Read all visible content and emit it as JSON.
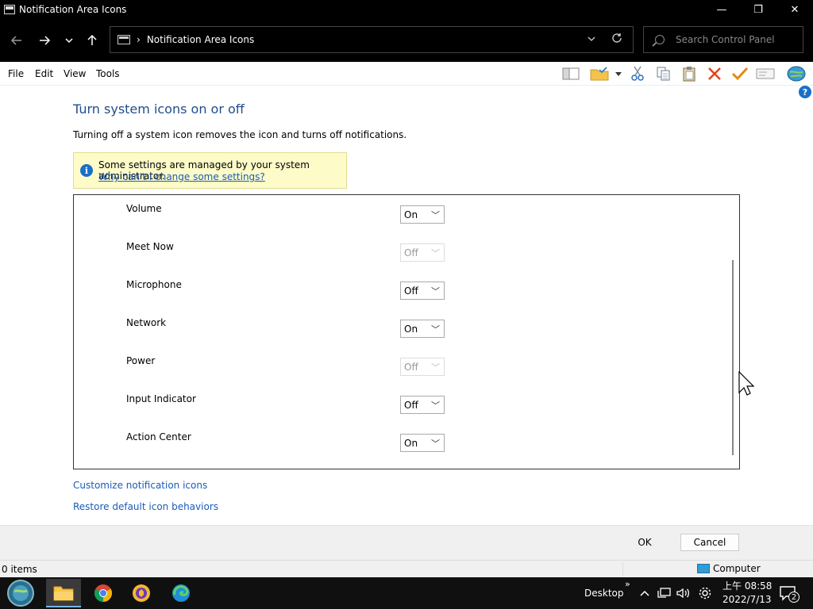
{
  "window": {
    "title": "Notification Area Icons",
    "min_glyph": "—",
    "max_glyph": "❐",
    "close_glyph": "✕"
  },
  "address": {
    "separator": "›",
    "path": "Notification Area Icons",
    "search_placeholder": "Search Control Panel"
  },
  "menu": {
    "file": "File",
    "edit": "Edit",
    "view": "View",
    "tools": "Tools"
  },
  "content": {
    "heading": "Turn system icons on or off",
    "description": "Turning off a system icon removes the icon and turns off notifications.",
    "notice_text": "Some settings are managed by your system administrator.",
    "notice_link": "Why can't I change some settings?"
  },
  "icons": [
    {
      "label": "Volume",
      "value": "On",
      "enabled": true
    },
    {
      "label": "Meet Now",
      "value": "Off",
      "enabled": false
    },
    {
      "label": "Microphone",
      "value": "Off",
      "enabled": true
    },
    {
      "label": "Network",
      "value": "On",
      "enabled": true
    },
    {
      "label": "Power",
      "value": "Off",
      "enabled": false
    },
    {
      "label": "Input Indicator",
      "value": "Off",
      "enabled": true
    },
    {
      "label": "Action Center",
      "value": "On",
      "enabled": true
    }
  ],
  "links": {
    "customize": "Customize notification icons",
    "restore": "Restore default icon behaviors"
  },
  "buttons": {
    "ok": "OK",
    "cancel": "Cancel"
  },
  "status": {
    "items": "0 items",
    "location": "Computer"
  },
  "taskbar": {
    "desktop_label": "Desktop",
    "time": "上午 08:58",
    "date": "2022/7/13",
    "notification_count": "2"
  },
  "colors": {
    "heading": "#1e4e8c",
    "link": "#1a5cb8",
    "notice_bg": "#fdfbc8",
    "info_icon": "#1a6fc9"
  }
}
